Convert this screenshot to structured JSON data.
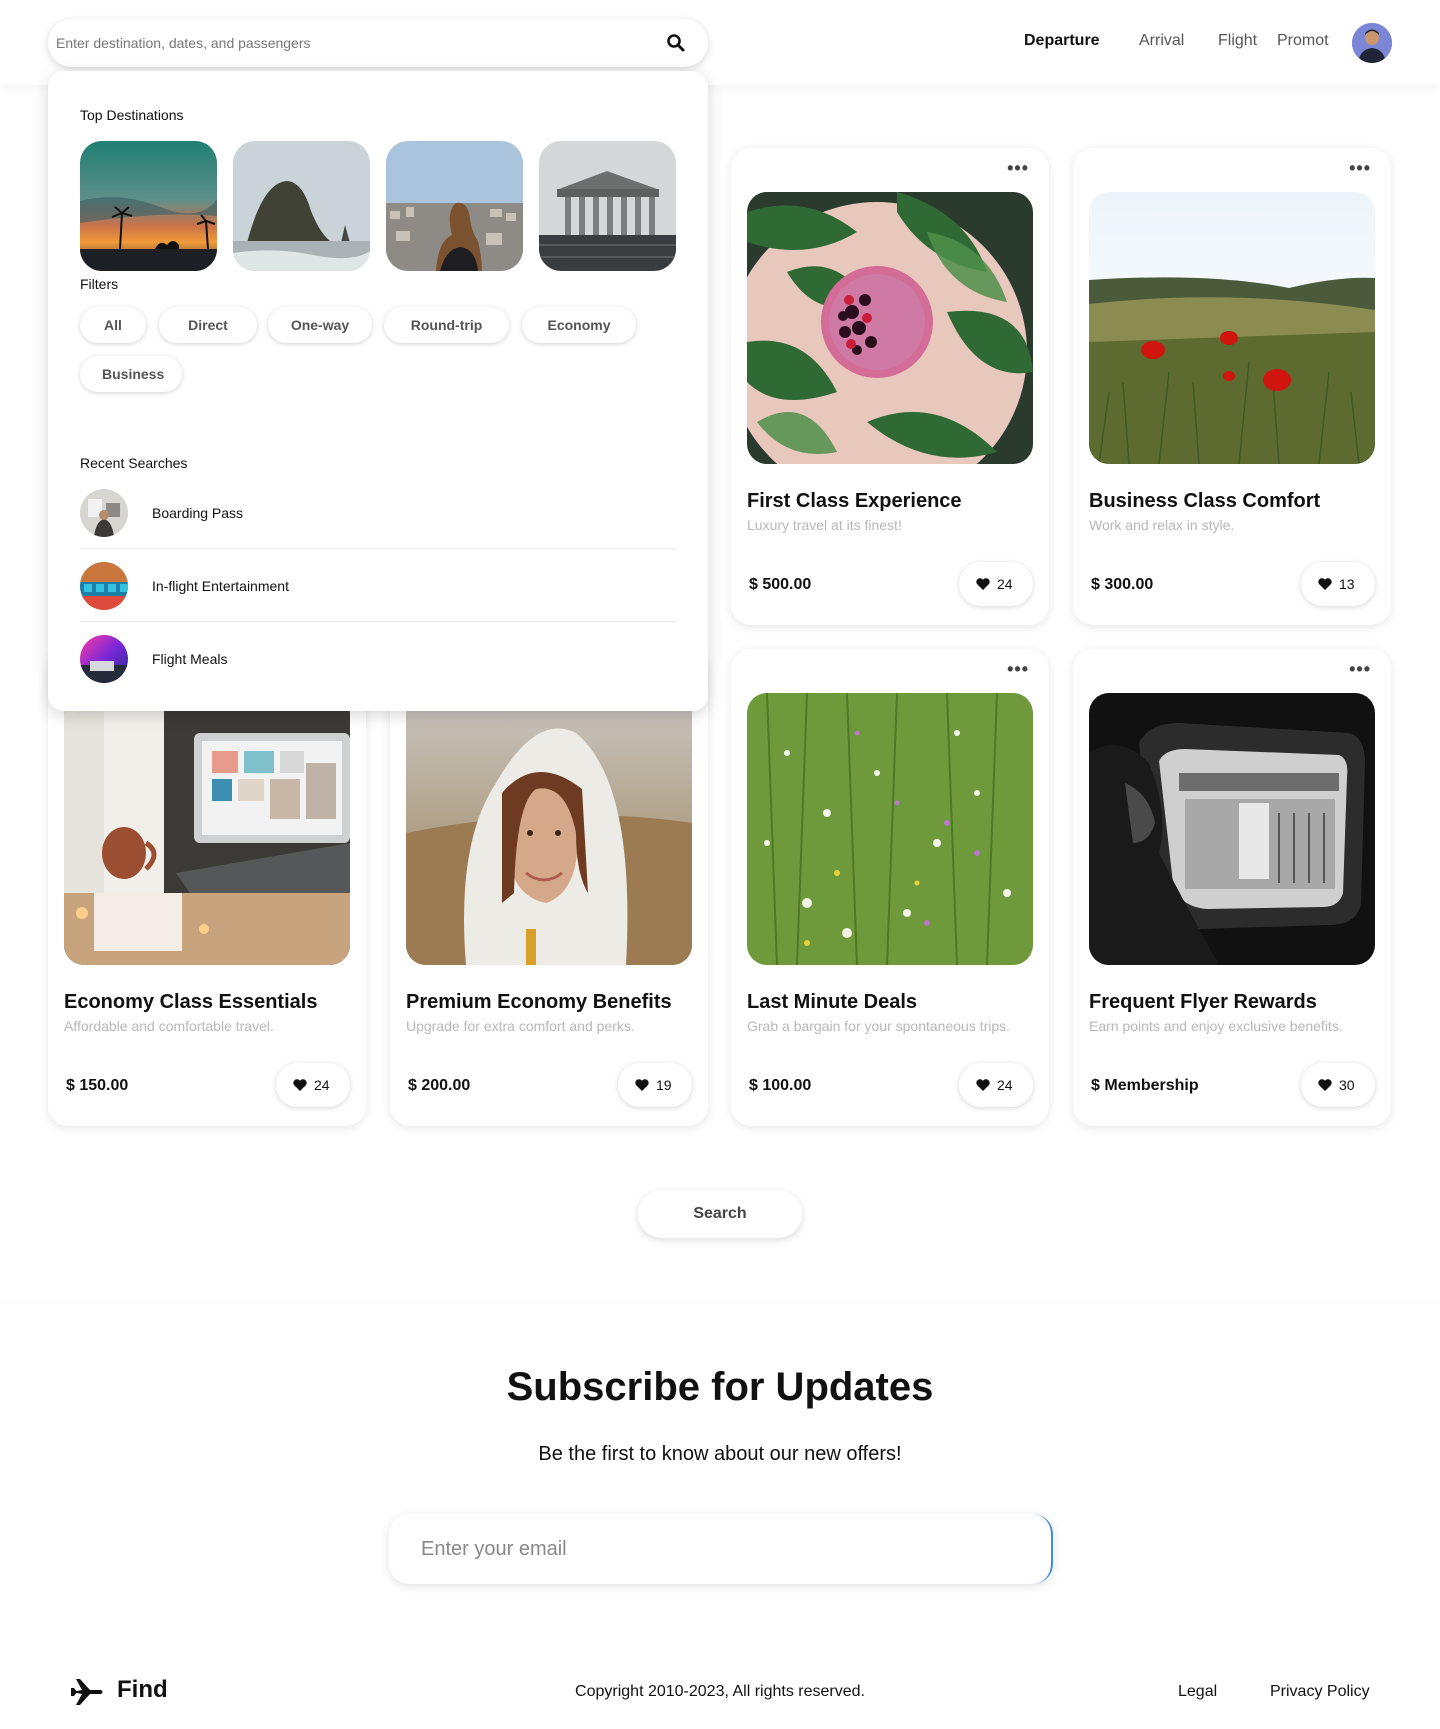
{
  "header": {
    "search_placeholder": "Enter destination, dates, and passengers",
    "nav": [
      {
        "label": "Departure",
        "active": true
      },
      {
        "label": "Arrival",
        "active": false
      },
      {
        "label": "Flight",
        "active": false
      },
      {
        "label": "Promot",
        "active": false
      }
    ]
  },
  "dropdown": {
    "top_destinations_title": "Top Destinations",
    "filters_title": "Filters",
    "filters": [
      "All",
      "Direct",
      "One-way",
      "Round-trip",
      "Economy",
      "Business"
    ],
    "recent_title": "Recent Searches",
    "recent": [
      {
        "label": "Boarding Pass"
      },
      {
        "label": "In-flight Entertainment"
      },
      {
        "label": "Flight Meals"
      }
    ]
  },
  "cards": [
    {
      "title": "First Class Experience",
      "subtitle": "Luxury travel at its finest!",
      "price": "500.00",
      "likes": "24"
    },
    {
      "title": "Business Class Comfort",
      "subtitle": "Work and relax in style.",
      "price": "300.00",
      "likes": "13"
    },
    {
      "title": "Economy Class Essentials",
      "subtitle": "Affordable and comfortable travel.",
      "price": "150.00",
      "likes": "24"
    },
    {
      "title": "Premium Economy Benefits",
      "subtitle": "Upgrade for extra comfort and perks.",
      "price": "200.00",
      "likes": "19"
    },
    {
      "title": "Last Minute Deals",
      "subtitle": "Grab a bargain for your spontaneous trips.",
      "price": "100.00",
      "likes": "24"
    },
    {
      "title": "Frequent Flyer Rewards",
      "subtitle": "Earn points and enjoy exclusive benefits.",
      "price": "Membership",
      "likes": "30"
    }
  ],
  "currency_symbol": "$",
  "more_glyph": "•••",
  "search_button": "Search",
  "subscribe": {
    "title": "Subscribe for Updates",
    "text": "Be the first to know about our new offers!",
    "email_placeholder": "Enter your email"
  },
  "footer": {
    "brand": "Find",
    "copyright": "Copyright 2010-2023, All rights reserved.",
    "links": [
      "Legal",
      "Privacy Policy"
    ]
  },
  "colors": {
    "accent_border": "#3d8fd8",
    "muted_text": "#b8b8b8"
  }
}
